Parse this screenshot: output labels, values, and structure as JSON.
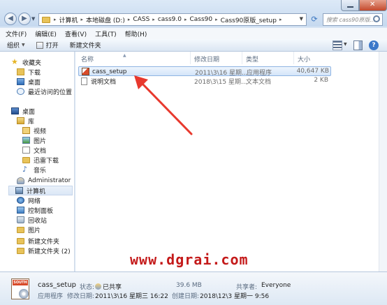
{
  "address": {
    "breadcrumbs": [
      "计算机",
      "本地磁盘 (D:)",
      "CASS",
      "cass9.0",
      "Cass90",
      "Cass90原版_setup"
    ],
    "search_placeholder": "搜索 cass90原版..."
  },
  "menu": [
    "文件(F)",
    "编辑(E)",
    "查看(V)",
    "工具(T)",
    "帮助(H)"
  ],
  "toolbar": {
    "organize": "组织",
    "open": "打开",
    "new_folder": "新建文件夹"
  },
  "nav": [
    {
      "label": "收藏夹",
      "icon": "star-icon"
    },
    {
      "label": "下载",
      "icon": "download-folder-icon"
    },
    {
      "label": "桌面",
      "icon": "desktop-icon"
    },
    {
      "label": "最近访问的位置",
      "icon": "recent-places-icon"
    },
    {
      "label": "桌面",
      "icon": "desktop-icon"
    },
    {
      "label": "库",
      "icon": "library-icon"
    },
    {
      "label": "视频",
      "icon": "video-icon"
    },
    {
      "label": "图片",
      "icon": "pictures-icon"
    },
    {
      "label": "文档",
      "icon": "documents-icon"
    },
    {
      "label": "迅雷下载",
      "icon": "folder-icon"
    },
    {
      "label": "音乐",
      "icon": "music-icon"
    },
    {
      "label": "Administrator",
      "icon": "user-icon"
    },
    {
      "label": "计算机",
      "icon": "computer-icon"
    },
    {
      "label": "网络",
      "icon": "network-icon"
    },
    {
      "label": "控制面板",
      "icon": "control-panel-icon"
    },
    {
      "label": "回收站",
      "icon": "recycle-bin-icon"
    },
    {
      "label": "图片",
      "icon": "folder-icon"
    },
    {
      "label": "新建文件夹",
      "icon": "folder-icon"
    },
    {
      "label": "新建文件夹 (2)",
      "icon": "folder-icon"
    }
  ],
  "columns": {
    "name": "名称",
    "date": "修改日期",
    "type": "类型",
    "size": "大小"
  },
  "files": [
    {
      "name": "cass_setup",
      "date": "2011\\3\\16 星期...",
      "type": "应用程序",
      "size": "40,647 KB"
    },
    {
      "name": "说明文档",
      "date": "2018\\3\\15 星期...",
      "type": "文本文档",
      "size": "2 KB"
    }
  ],
  "details": {
    "name": "cass_setup",
    "type": "应用程序",
    "state_label": "状态:",
    "state_value": "已共享",
    "size_fragment": "39.6 MB",
    "share_label": "共享者:",
    "share_value": "Everyone",
    "modified_label": "修改日期:",
    "modified_value": "2011\\3\\16 星期三 16:22",
    "created_label": "创建日期:",
    "created_value": "2018\\12\\3 星期一 9:56"
  },
  "watermark": "www.dgrai.com",
  "colors": {
    "arrow": "#e8392e",
    "watermark": "#c41a1a",
    "selection": "#d4e5f9"
  }
}
